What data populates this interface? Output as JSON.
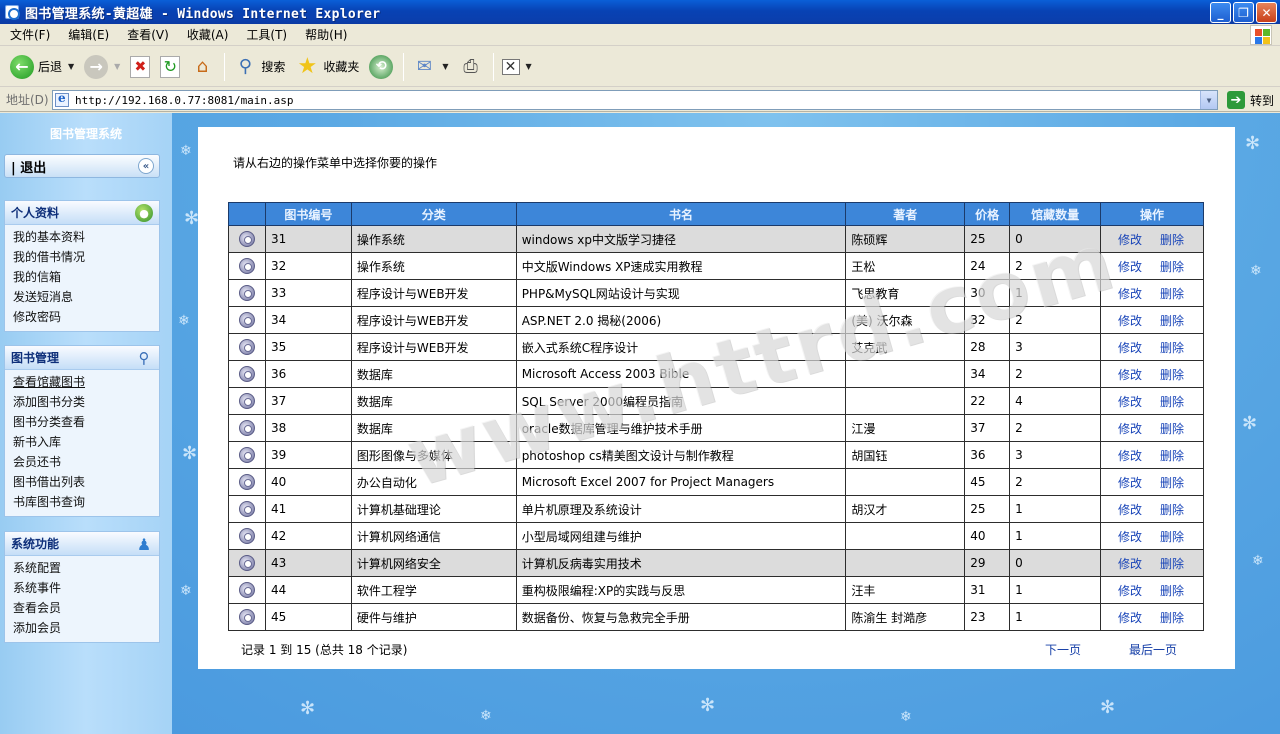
{
  "window": {
    "title": "图书管理系统-黄超雄 - Windows Internet Explorer",
    "buttons": [
      "_",
      "❐",
      "✕"
    ]
  },
  "menu": [
    "文件(F)",
    "编辑(E)",
    "查看(V)",
    "收藏(A)",
    "工具(T)",
    "帮助(H)"
  ],
  "toolbar": {
    "back_label": "后退",
    "search_label": "搜索",
    "favorites_label": "收藏夹"
  },
  "address": {
    "label": "地址(D)",
    "url": "http://192.168.0.77:8081/main.asp",
    "go_label": "转到"
  },
  "sidebar": {
    "title": "图书管理系统",
    "logout": "| 退出",
    "panels": [
      {
        "title": "个人资料",
        "icon": "globe-icon",
        "items": [
          "我的基本资料",
          "我的借书情况",
          "我的信箱",
          "发送短消息",
          "修改密码"
        ]
      },
      {
        "title": "图书管理",
        "icon": "magnifier-icon",
        "items": [
          "查看馆藏图书",
          "添加图书分类",
          "图书分类查看",
          "新书入库",
          "会员还书",
          "图书借出列表",
          "书库图书查询"
        ]
      },
      {
        "title": "系统功能",
        "icon": "user-icon",
        "items": [
          "系统配置",
          "系统事件",
          "查看会员",
          "添加会员"
        ]
      }
    ]
  },
  "main": {
    "intro": "请从右边的操作菜单中选择你要的操作",
    "columns": [
      "",
      "图书编号",
      "分类",
      "书名",
      "著者",
      "价格",
      "馆藏数量",
      "操作"
    ],
    "edit_label": "修改",
    "delete_label": "删除",
    "rows": [
      {
        "id": "31",
        "category": "操作系统",
        "title": "windows xp中文版学习捷径",
        "author": "陈硕辉",
        "price": "25",
        "qty": "0",
        "shade": true
      },
      {
        "id": "32",
        "category": "操作系统",
        "title": "中文版Windows XP速成实用教程",
        "author": "王松",
        "price": "24",
        "qty": "2",
        "shade": false
      },
      {
        "id": "33",
        "category": "程序设计与WEB开发",
        "title": "PHP&MySQL网站设计与实现",
        "author": "飞思教育",
        "price": "30",
        "qty": "1",
        "shade": false
      },
      {
        "id": "34",
        "category": "程序设计与WEB开发",
        "title": "ASP.NET 2.0 揭秘(2006)",
        "author": "(美) 沃尔森",
        "price": "32",
        "qty": "2",
        "shade": false
      },
      {
        "id": "35",
        "category": "程序设计与WEB开发",
        "title": "嵌入式系统C程序设计",
        "author": "艾克武",
        "price": "28",
        "qty": "3",
        "shade": false
      },
      {
        "id": "36",
        "category": "数据库",
        "title": "Microsoft Access 2003 Bible",
        "author": "",
        "price": "34",
        "qty": "2",
        "shade": false
      },
      {
        "id": "37",
        "category": "数据库",
        "title": "SQL Server 2000编程员指南",
        "author": "",
        "price": "22",
        "qty": "4",
        "shade": false
      },
      {
        "id": "38",
        "category": "数据库",
        "title": "oracle数据库管理与维护技术手册",
        "author": "江漫",
        "price": "37",
        "qty": "2",
        "shade": false
      },
      {
        "id": "39",
        "category": "图形图像与多媒体",
        "title": "photoshop cs精美图文设计与制作教程",
        "author": "胡国钰",
        "price": "36",
        "qty": "3",
        "shade": false
      },
      {
        "id": "40",
        "category": "办公自动化",
        "title": "Microsoft Excel 2007 for Project Managers",
        "author": "",
        "price": "45",
        "qty": "2",
        "shade": false
      },
      {
        "id": "41",
        "category": "计算机基础理论",
        "title": "单片机原理及系统设计",
        "author": "胡汉才",
        "price": "25",
        "qty": "1",
        "shade": false
      },
      {
        "id": "42",
        "category": "计算机网络通信",
        "title": "小型局域网组建与维护",
        "author": "",
        "price": "40",
        "qty": "1",
        "shade": false
      },
      {
        "id": "43",
        "category": "计算机网络安全",
        "title": "计算机反病毒实用技术",
        "author": "",
        "price": "29",
        "qty": "0",
        "shade": true
      },
      {
        "id": "44",
        "category": "软件工程学",
        "title": "重构极限编程:XP的实践与反思",
        "author": "汪丰",
        "price": "31",
        "qty": "1",
        "shade": false
      },
      {
        "id": "45",
        "category": "硬件与维护",
        "title": "数据备份、恢复与急救完全手册",
        "author": "陈渝生 封澔彦",
        "price": "23",
        "qty": "1",
        "shade": false
      }
    ],
    "record_text": "记录 1 到 15 (总共 18 个记录)",
    "next_page": "下一页",
    "last_page": "最后一页"
  },
  "watermark": "www.httrd.com",
  "colors": {
    "header_blue": "#3d86d9",
    "link_blue": "#1844b8",
    "page_bg": "#5ba9e4"
  }
}
